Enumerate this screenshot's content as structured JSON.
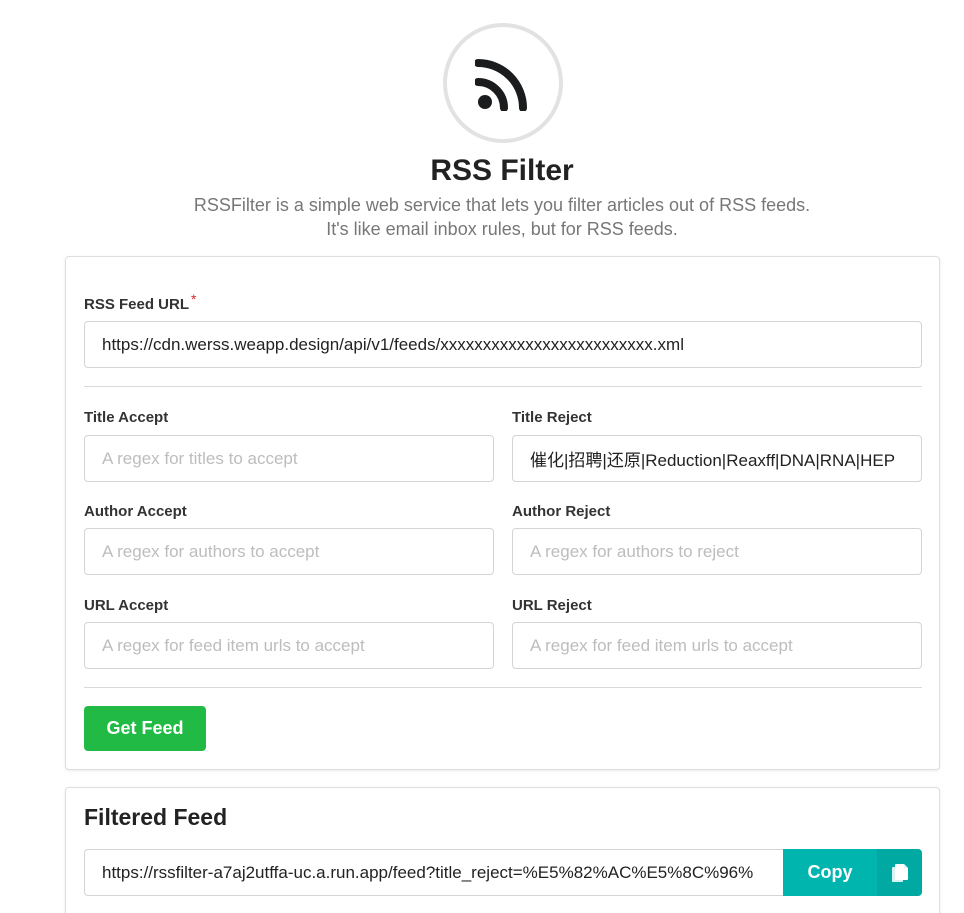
{
  "header": {
    "title": "RSS Filter",
    "subtitle_line1": "RSSFilter is a simple web service that lets you filter articles out of RSS feeds.",
    "subtitle_line2": "It's like email inbox rules, but for RSS feeds."
  },
  "form": {
    "feed_url": {
      "label": "RSS Feed URL",
      "required_mark": "*",
      "value": "https://cdn.werss.weapp.design/api/v1/feeds/xxxxxxxxxxxxxxxxxxxxxxxxx.xml"
    },
    "title_accept": {
      "label": "Title Accept",
      "value": "",
      "placeholder": "A regex for titles to accept"
    },
    "title_reject": {
      "label": "Title Reject",
      "value": "催化|招聘|还原|Reduction|Reaxff|DNA|RNA|HEP",
      "placeholder": ""
    },
    "author_accept": {
      "label": "Author Accept",
      "value": "",
      "placeholder": "A regex for authors to accept"
    },
    "author_reject": {
      "label": "Author Reject",
      "value": "",
      "placeholder": "A regex for authors to reject"
    },
    "url_accept": {
      "label": "URL Accept",
      "value": "",
      "placeholder": "A regex for feed item urls to accept"
    },
    "url_reject": {
      "label": "URL Reject",
      "value": "",
      "placeholder": "A regex for feed item urls to accept"
    },
    "submit_label": "Get Feed"
  },
  "result": {
    "title": "Filtered Feed",
    "url": "https://rssfilter-a7aj2utffa-uc.a.run.app/feed?title_reject=%E5%82%AC%E5%8C%96%",
    "copy_label": "Copy",
    "copy_icon": "copy-icon"
  },
  "colors": {
    "primary_green": "#21ba45",
    "teal": "#00b5ad",
    "required_red": "#db2828"
  }
}
